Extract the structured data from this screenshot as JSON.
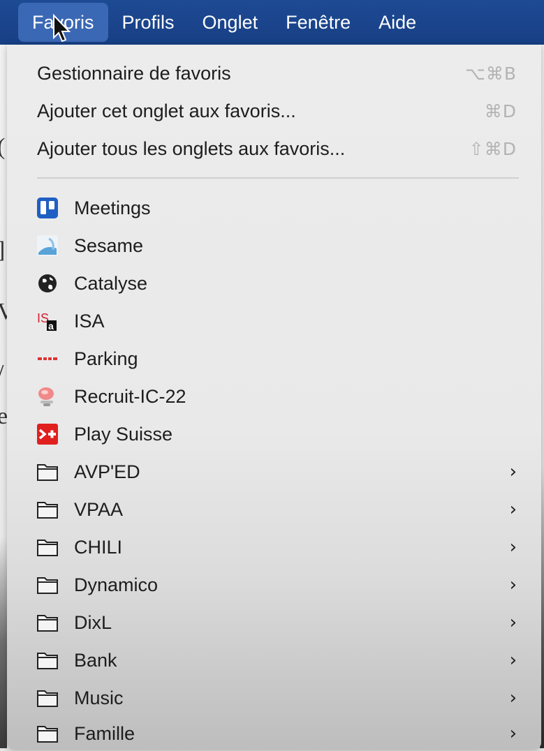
{
  "menubar": {
    "items": [
      {
        "label": "Favoris",
        "active": true
      },
      {
        "label": "Profils"
      },
      {
        "label": "Onglet"
      },
      {
        "label": "Fenêtre"
      },
      {
        "label": "Aide"
      }
    ]
  },
  "menu": {
    "commands": [
      {
        "label": "Gestionnaire de favoris",
        "shortcut": "⌥⌘B"
      },
      {
        "label": "Ajouter cet onglet aux favoris...",
        "shortcut": "⌘D"
      },
      {
        "label": "Ajouter tous les onglets aux favoris...",
        "shortcut": "⇧⌘D"
      }
    ],
    "bookmarks": [
      {
        "label": "Meetings",
        "icon": "trello-icon"
      },
      {
        "label": "Sesame",
        "icon": "sesame-icon"
      },
      {
        "label": "Catalyse",
        "icon": "globe-icon"
      },
      {
        "label": "ISA",
        "icon": "isa-icon"
      },
      {
        "label": "Parking",
        "icon": "parking-icon"
      },
      {
        "label": "Recruit-IC-22",
        "icon": "recruit-icon"
      },
      {
        "label": "Play Suisse",
        "icon": "play-suisse-icon"
      }
    ],
    "folders": [
      {
        "label": "AVP'ED"
      },
      {
        "label": "VPAA"
      },
      {
        "label": "CHILI"
      },
      {
        "label": "Dynamico"
      },
      {
        "label": "DixL"
      },
      {
        "label": "Bank"
      },
      {
        "label": "Music"
      },
      {
        "label": "Famille"
      }
    ]
  },
  "colors": {
    "menubar": "#1e4a94",
    "menubar_active": "#3b68b4",
    "shortcut_text": "#b3b3b3",
    "play_suisse": "#e0201f",
    "isa_red": "#d1202f"
  }
}
